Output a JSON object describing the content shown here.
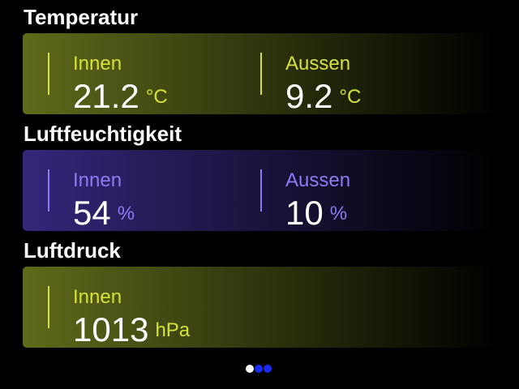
{
  "colors": {
    "background": "#000000",
    "temp_accent": "#d6e23a",
    "temp_card_start": "#5f6a1a",
    "humidity_accent": "#8a7cf2",
    "humidity_card_start": "#33277a",
    "pressure_accent": "#d6e23a",
    "pressure_card_start": "#5f6a1a",
    "dot_active": "#ffffff",
    "dot_inactive": "#1d2cf5"
  },
  "sections": {
    "temperature": {
      "title": "Temperatur",
      "inside": {
        "label": "Innen",
        "value": "21.2",
        "unit": "°C"
      },
      "outside": {
        "label": "Aussen",
        "value": "9.2",
        "unit": "°C"
      }
    },
    "humidity": {
      "title": "Luftfeuchtigkeit",
      "inside": {
        "label": "Innen",
        "value": "54",
        "unit": "%"
      },
      "outside": {
        "label": "Aussen",
        "value": "10",
        "unit": "%"
      }
    },
    "pressure": {
      "title": "Luftdruck",
      "inside": {
        "label": "Innen",
        "value": "1013",
        "unit": "hPa"
      }
    }
  },
  "pager": {
    "page_count": 3,
    "active_index": 0
  }
}
